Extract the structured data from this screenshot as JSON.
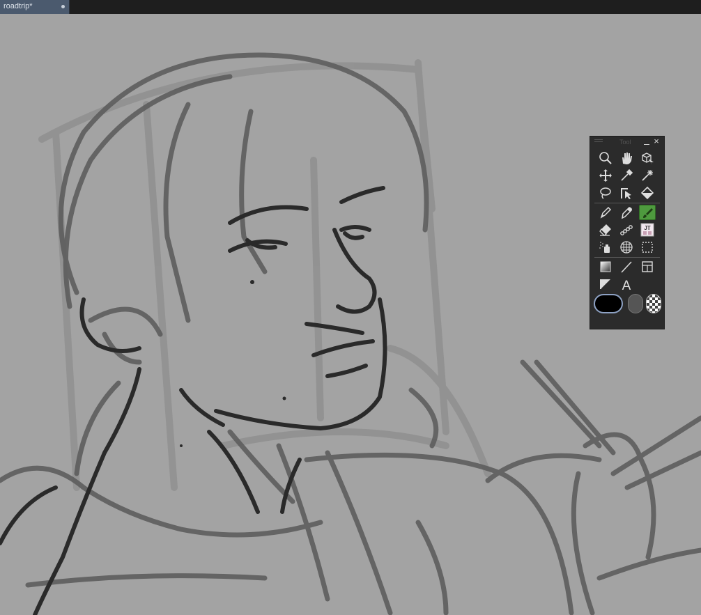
{
  "window": {
    "tabs": [
      {
        "label": "roadtrip*",
        "modified": true
      }
    ]
  },
  "tool_palette": {
    "title": "Tool",
    "close_glyph": "×",
    "tools": [
      {
        "icon": "zoom-icon"
      },
      {
        "icon": "hand-icon"
      },
      {
        "icon": "object-icon"
      },
      {
        "icon": "move-icon"
      },
      {
        "icon": "eyedropper-icon"
      },
      {
        "icon": "auto-select-icon"
      },
      {
        "icon": "lasso-icon"
      },
      {
        "icon": "operation-icon"
      },
      {
        "icon": "fill-icon"
      },
      {
        "icon": "pen-icon"
      },
      {
        "icon": "pencil-icon"
      },
      {
        "icon": "brush-icon",
        "active": true
      },
      {
        "icon": "eraser-icon"
      },
      {
        "icon": "decoration-icon"
      },
      {
        "icon": "jt-plugin-icon"
      },
      {
        "icon": "airbrush-icon"
      },
      {
        "icon": "grid-ruler-icon"
      },
      {
        "icon": "selection-icon"
      },
      {
        "icon": "gradient-icon"
      },
      {
        "icon": "line-icon"
      },
      {
        "icon": "frame-icon"
      },
      {
        "icon": "balloon-tail-icon"
      },
      {
        "icon": "text-icon"
      }
    ],
    "jt_badge_text": "JT",
    "text_tool_glyph": "A",
    "colors": {
      "main": "#000000",
      "sub": "#555555",
      "transparent": "checkerboard"
    }
  },
  "canvas": {
    "background": "#a3a3a3",
    "stroke_color": "#2a2a2a"
  }
}
